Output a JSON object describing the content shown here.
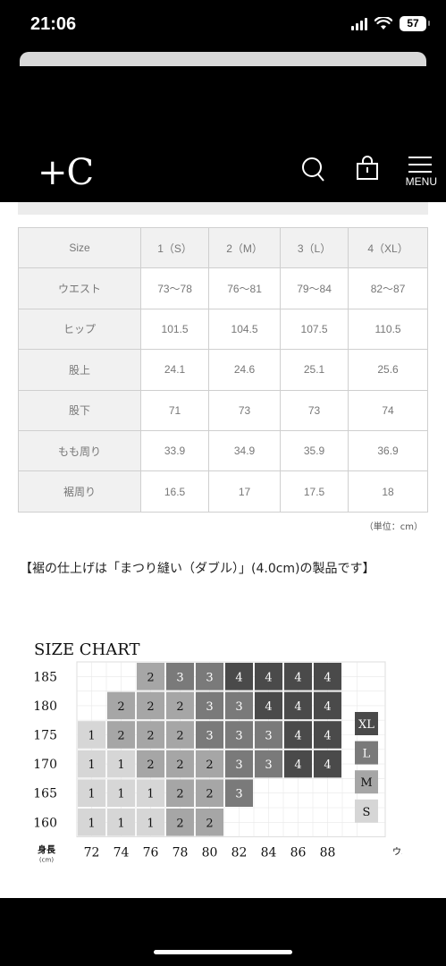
{
  "status_bar": {
    "time": "21:06",
    "battery": "57"
  },
  "header": {
    "logo": "+C",
    "menu_label": "MENU",
    "icons": [
      "search-icon",
      "bag-icon",
      "hamburger-icon"
    ]
  },
  "size_table": {
    "columns": [
      "Size",
      "1（S）",
      "2（M）",
      "3（L）",
      "4（XL）"
    ],
    "rows": [
      {
        "label": "ウエスト",
        "values": [
          "73〜78",
          "76〜81",
          "79〜84",
          "82〜87"
        ]
      },
      {
        "label": "ヒップ",
        "values": [
          "101.5",
          "104.5",
          "107.5",
          "110.5"
        ]
      },
      {
        "label": "股上",
        "values": [
          "24.1",
          "24.6",
          "25.1",
          "25.6"
        ]
      },
      {
        "label": "股下",
        "values": [
          "71",
          "73",
          "73",
          "74"
        ]
      },
      {
        "label": "もも周り",
        "values": [
          "33.9",
          "34.9",
          "35.9",
          "36.9"
        ]
      },
      {
        "label": "裾周り",
        "values": [
          "16.5",
          "17",
          "17.5",
          "18"
        ]
      }
    ],
    "unit_note": "（単位：cm）"
  },
  "finish_note": "【裾の仕上げは「まつり縫い（ダブル）」(4.0cm)の製品です】",
  "chart_data": {
    "type": "heatmap",
    "title": "SIZE CHART",
    "xlabel": "ウエスト",
    "xunit": "(cm)",
    "ylabel": "身長",
    "yunit": "(cm)",
    "x": [
      "72",
      "74",
      "76",
      "78",
      "80",
      "82",
      "84",
      "86",
      "88"
    ],
    "y": [
      "185",
      "180",
      "175",
      "170",
      "165",
      "160"
    ],
    "cells": [
      [
        null,
        null,
        "2",
        "3",
        "3",
        "4",
        "4",
        "4",
        "4"
      ],
      [
        null,
        "2",
        "2",
        "2",
        "3",
        "3",
        "4",
        "4",
        "4"
      ],
      [
        "1",
        "2",
        "2",
        "2",
        "3",
        "3",
        "3",
        "4",
        "4"
      ],
      [
        "1",
        "1",
        "2",
        "2",
        "2",
        "3",
        "3",
        "4",
        "4"
      ],
      [
        "1",
        "1",
        "1",
        "2",
        "2",
        "3",
        null,
        null,
        null
      ],
      [
        "1",
        "1",
        "1",
        "2",
        "2",
        null,
        null,
        null,
        null
      ]
    ],
    "legend": [
      {
        "label": "XL",
        "color": "#4a4a4a"
      },
      {
        "label": "L",
        "color": "#7a7a7a"
      },
      {
        "label": "M",
        "color": "#a6a6a6"
      },
      {
        "label": "S",
        "color": "#d6d6d6"
      }
    ],
    "level_colors": {
      "1": "#d6d6d6",
      "2": "#a6a6a6",
      "3": "#7a7a7a",
      "4": "#4a4a4a"
    }
  }
}
